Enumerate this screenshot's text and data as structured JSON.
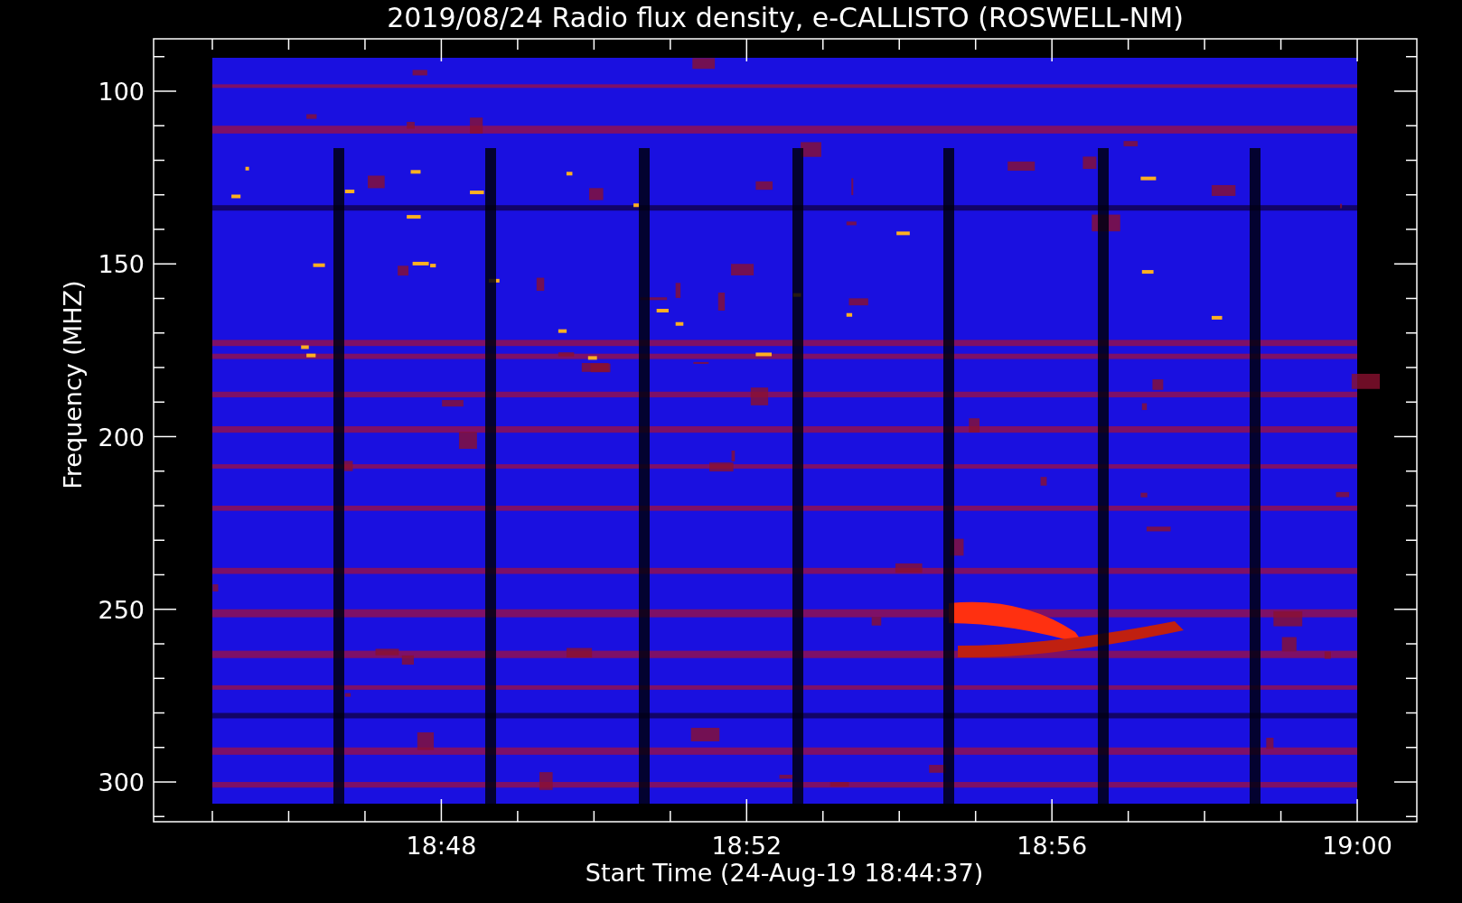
{
  "plot": {
    "title": "2019/08/24  Radio flux density, e-CALLISTO (ROSWELL-NM)",
    "y_axis": {
      "label": "Frequency (MHZ)",
      "ticks": [
        "100",
        "150",
        "200",
        "250",
        "300"
      ]
    },
    "x_axis": {
      "label": "Start Time (24-Aug-19 18:44:37)",
      "ticks": [
        "18:48",
        "18:52",
        "18:56",
        "19:00"
      ]
    }
  }
}
